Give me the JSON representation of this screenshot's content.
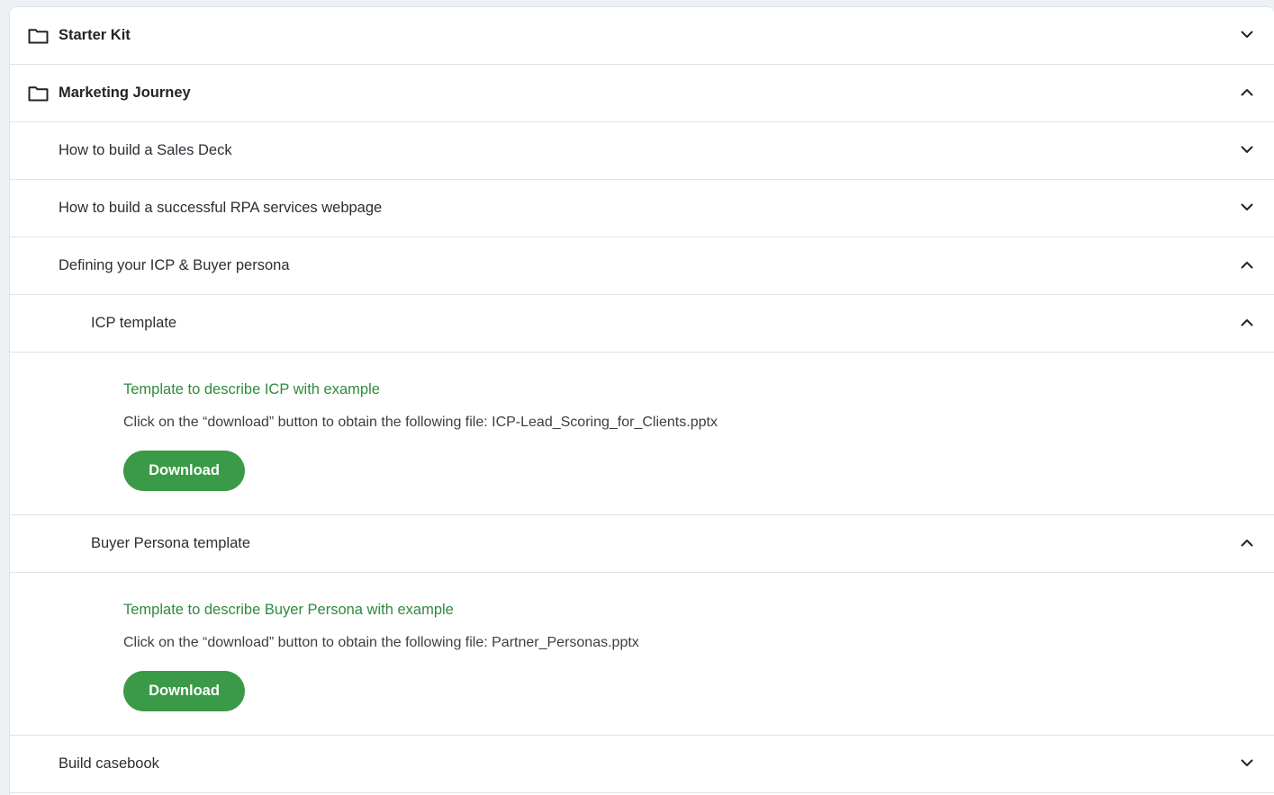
{
  "sections": {
    "starter_kit": {
      "label": "Starter Kit",
      "icon": "folder-icon",
      "state": "collapsed"
    },
    "marketing_journey": {
      "label": "Marketing Journey",
      "icon": "folder-icon",
      "state": "expanded"
    }
  },
  "items": {
    "sales_deck": {
      "label": "How to build a Sales Deck",
      "state": "collapsed"
    },
    "rpa_webpage": {
      "label": "How to build a successful RPA services webpage",
      "state": "collapsed"
    },
    "icp_buyer": {
      "label": "Defining your ICP & Buyer persona",
      "state": "expanded"
    },
    "casebook": {
      "label": "Build casebook",
      "state": "collapsed"
    }
  },
  "subitems": {
    "icp_template": {
      "label": "ICP template",
      "state": "expanded",
      "content_title": "Template to describe ICP with example",
      "content_desc": "Click on the “download” button to obtain the following file: ICP-Lead_Scoring_for_Clients.pptx",
      "button_label": "Download"
    },
    "buyer_persona_template": {
      "label": "Buyer Persona template",
      "state": "expanded",
      "content_title": "Template to describe Buyer Persona with example",
      "content_desc": "Click on the “download” button to obtain the following file: Partner_Personas.pptx",
      "button_label": "Download"
    }
  },
  "colors": {
    "accent_green": "#3a9a47",
    "title_green": "#2e8b3e",
    "border": "#dfe3e7"
  }
}
